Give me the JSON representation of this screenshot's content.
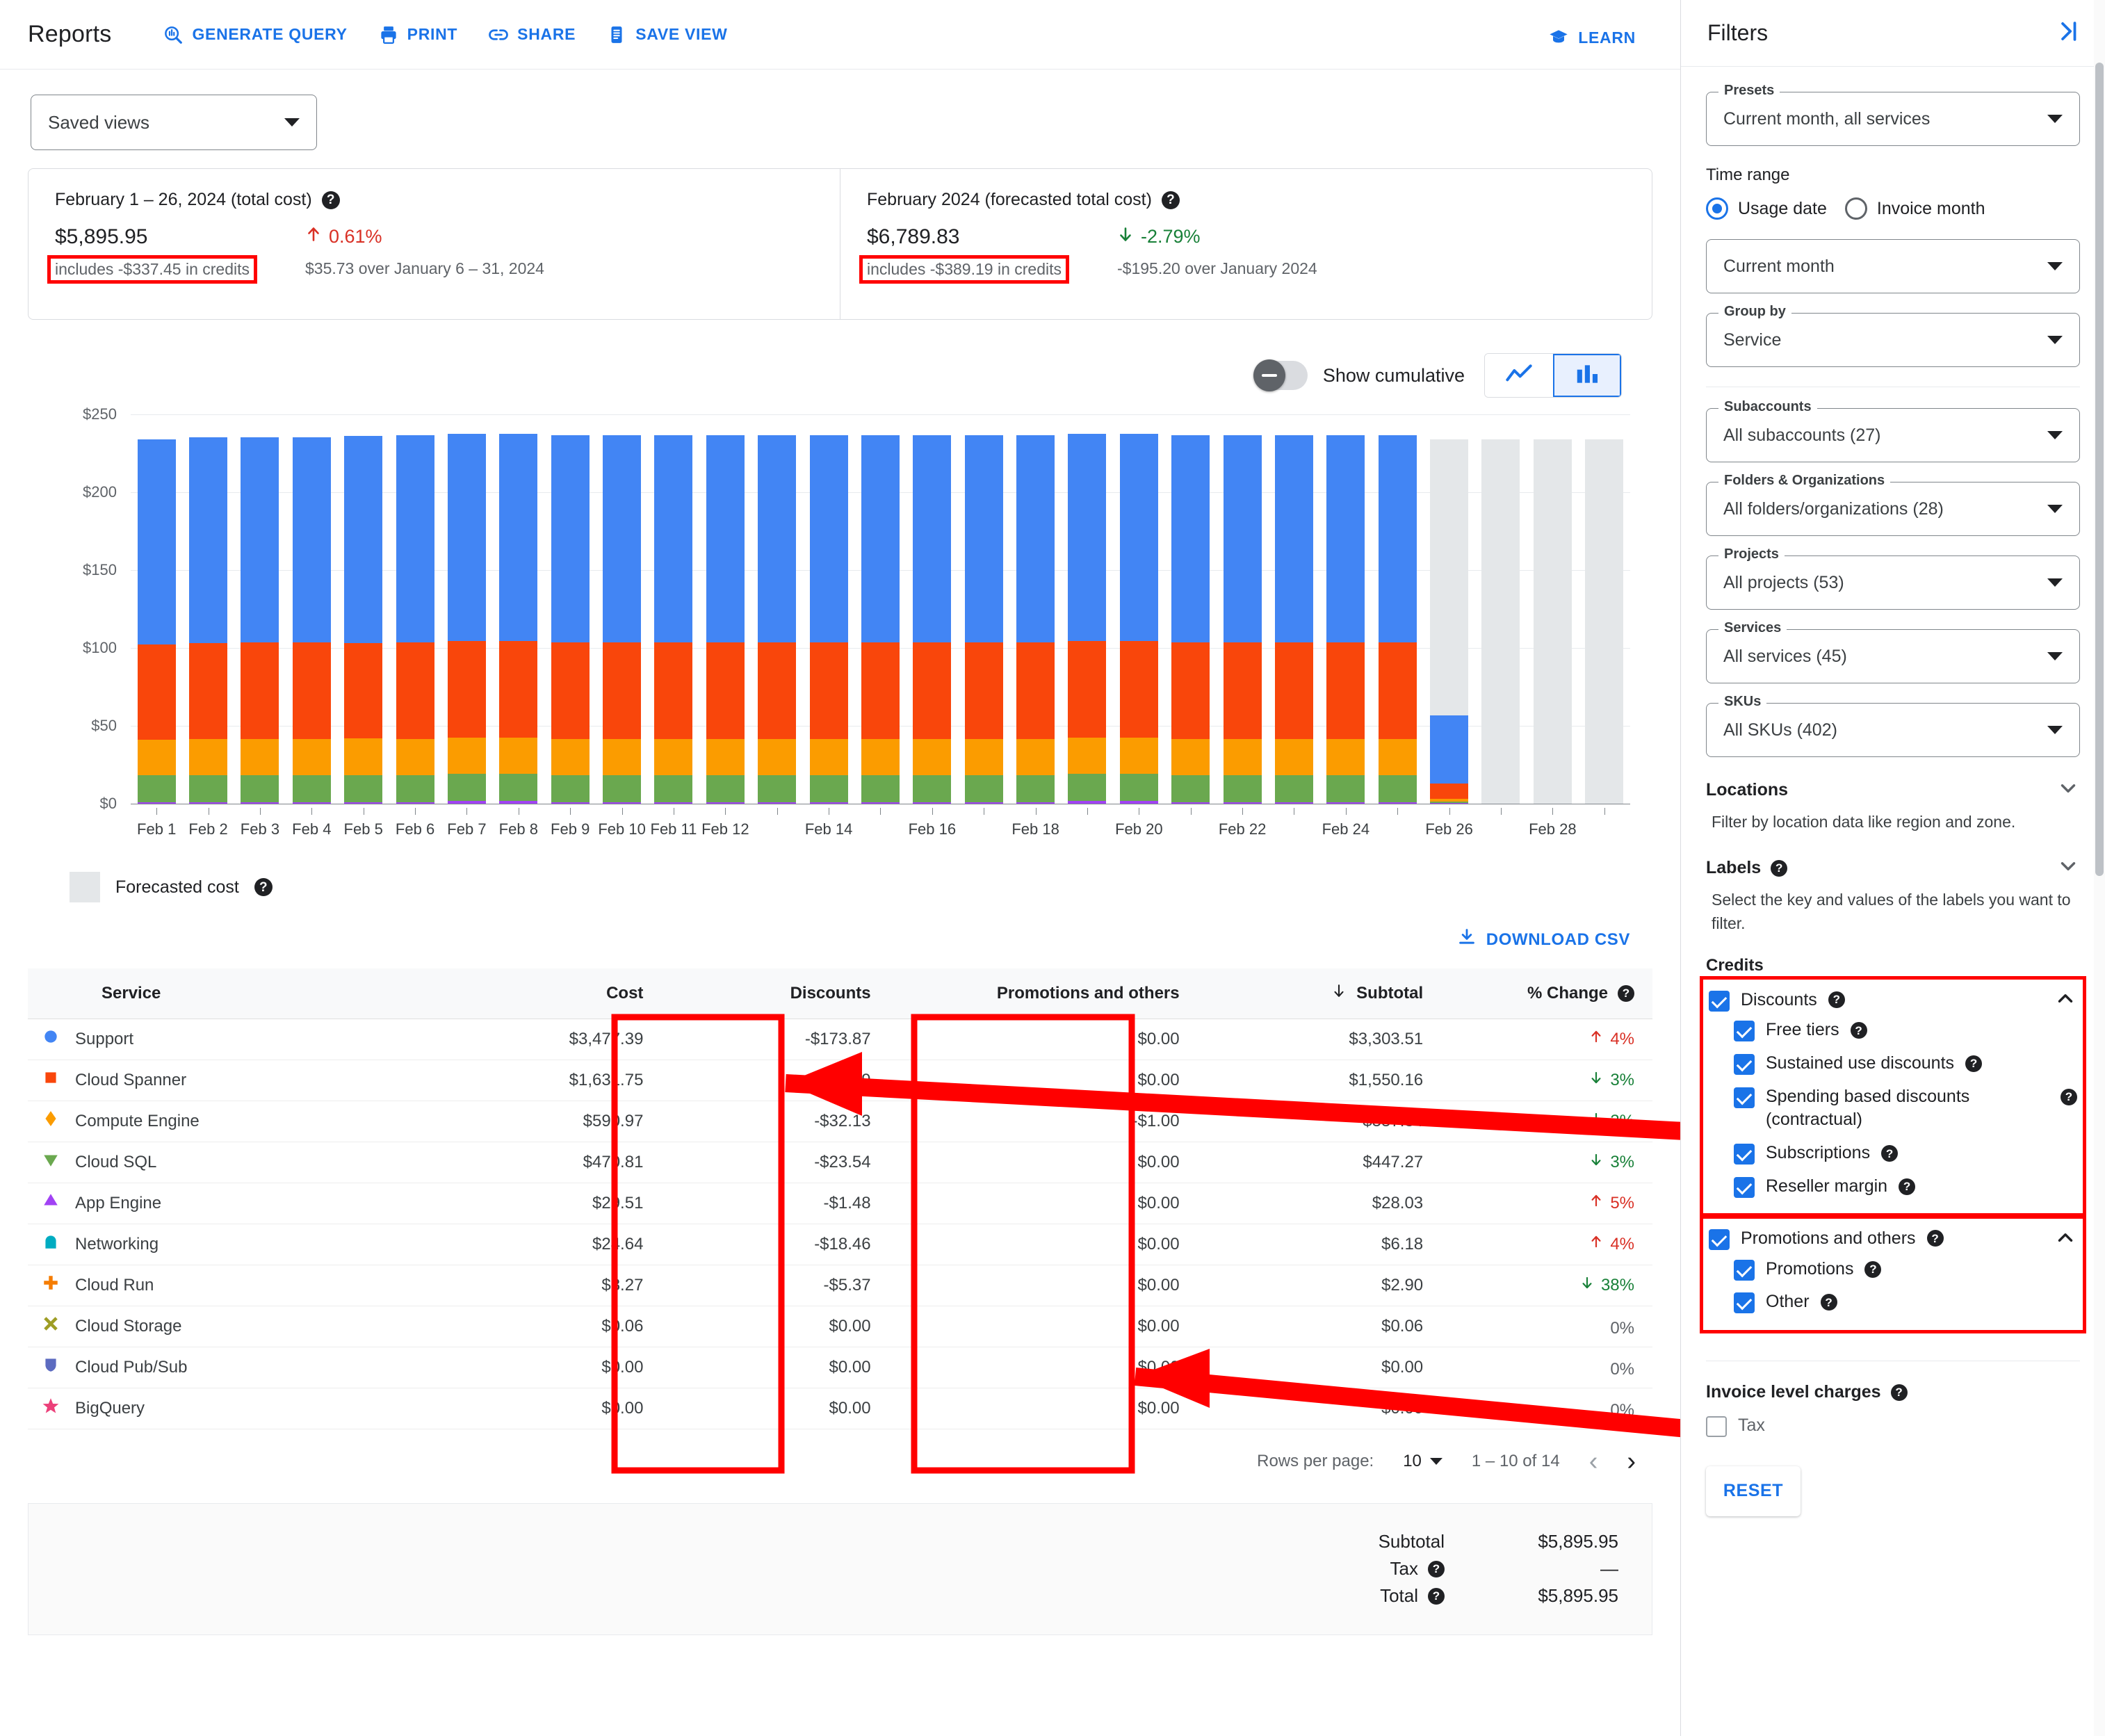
{
  "header": {
    "title": "Reports",
    "actions": [
      {
        "label": "GENERATE QUERY",
        "icon": "generate-query-icon"
      },
      {
        "label": "PRINT",
        "icon": "print-icon"
      },
      {
        "label": "SHARE",
        "icon": "share-icon"
      },
      {
        "label": "SAVE VIEW",
        "icon": "save-view-icon"
      }
    ],
    "learn_label": "LEARN"
  },
  "saved_views": {
    "label": "Saved views"
  },
  "summary": {
    "current": {
      "title": "February 1 – 26, 2024 (total cost)",
      "amount": "$5,895.95",
      "credits": "includes -$337.45 in credits",
      "change_pct": "0.61%",
      "change_dir": "up",
      "change_sub": "$35.73 over January 6 – 31, 2024"
    },
    "forecast": {
      "title": "February 2024 (forecasted total cost)",
      "amount": "$6,789.83",
      "credits": "includes -$389.19 in credits",
      "change_pct": "-2.79%",
      "change_dir": "down",
      "change_sub": "-$195.20 over January 2024"
    }
  },
  "chart_controls": {
    "cumulative_label": "Show cumulative",
    "cumulative_on": false,
    "line_icon": "line-chart-icon",
    "bar_icon": "bar-chart-icon",
    "selected_type": "bar"
  },
  "legend": {
    "forecast_label": "Forecasted cost",
    "forecast_color": "#e4e7e9"
  },
  "download": {
    "label": "DOWNLOAD CSV",
    "icon": "download-icon"
  },
  "chart_data": {
    "type": "bar",
    "stacked": true,
    "title": "",
    "xlabel": "",
    "ylabel": "",
    "ylim": [
      0,
      250
    ],
    "yticks": [
      "$0",
      "$50",
      "$100",
      "$150",
      "$200",
      "$250"
    ],
    "ytick_values": [
      0,
      50,
      100,
      150,
      200,
      250
    ],
    "grid": true,
    "legend_position": "below",
    "x": [
      "Feb 1",
      "Feb 2",
      "Feb 3",
      "Feb 4",
      "Feb 5",
      "Feb 6",
      "Feb 7",
      "Feb 8",
      "Feb 9",
      "Feb 10",
      "Feb 11",
      "Feb 12",
      "Feb 13",
      "Feb 14",
      "Feb 15",
      "Feb 16",
      "Feb 17",
      "Feb 18",
      "Feb 19",
      "Feb 20",
      "Feb 21",
      "Feb 22",
      "Feb 23",
      "Feb 24",
      "Feb 25",
      "Feb 26",
      "Feb 27",
      "Feb 28",
      "Feb 29"
    ],
    "xtick_labels": [
      "Feb 1",
      "Feb 2",
      "Feb 3",
      "Feb 4",
      "Feb 5",
      "Feb 6",
      "Feb 7",
      "Feb 8",
      "Feb 9",
      "Feb 10",
      "Feb 11",
      "Feb 12",
      "",
      "Feb 14",
      "",
      "Feb 16",
      "",
      "Feb 18",
      "",
      "Feb 20",
      "",
      "Feb 22",
      "",
      "Feb 24",
      "",
      "Feb 26",
      "",
      "Feb 28",
      ""
    ],
    "series": [
      {
        "name": "App Engine",
        "color": "#a142f4",
        "values": [
          1.1,
          1.1,
          1.1,
          1.1,
          1.1,
          1.1,
          1.9,
          1.9,
          1.1,
          1.1,
          1.1,
          1.1,
          1.1,
          1.1,
          1.1,
          1.1,
          1.1,
          1.1,
          1.9,
          1.9,
          1.1,
          1.1,
          1.1,
          1.1,
          1.1,
          0.25,
          0,
          0,
          0
        ]
      },
      {
        "name": "Cloud SQL",
        "color": "#6aa84f",
        "values": [
          17.3,
          17.3,
          17.3,
          17.3,
          17.3,
          17.3,
          17.3,
          17.3,
          17.3,
          17.3,
          17.3,
          17.3,
          17.3,
          17.3,
          17.3,
          17.3,
          17.3,
          17.3,
          17.3,
          17.3,
          17.3,
          17.3,
          17.3,
          17.3,
          17.3,
          1.2,
          0,
          0,
          0
        ]
      },
      {
        "name": "Compute Engine",
        "color": "#fb9c00",
        "values": [
          22.5,
          23.1,
          23.3,
          23.3,
          23.6,
          23.3,
          23.3,
          23.3,
          23.3,
          23.3,
          23.3,
          23.3,
          23.3,
          23.3,
          23.3,
          23.3,
          23.3,
          23.3,
          23.3,
          23.3,
          23.3,
          23.3,
          23.3,
          23.3,
          23.3,
          1.8,
          0,
          0,
          0
        ]
      },
      {
        "name": "Cloud Spanner",
        "color": "#f9460b",
        "values": [
          61.5,
          61.7,
          61.7,
          61.7,
          61.3,
          62.0,
          62.0,
          62.0,
          62.0,
          62.0,
          62.0,
          62.0,
          62.0,
          62.0,
          62.0,
          62.0,
          62.0,
          62.0,
          62.0,
          62.0,
          62.0,
          62.0,
          62.0,
          62.0,
          62.0,
          9.5,
          0,
          0,
          0
        ]
      },
      {
        "name": "Support",
        "color": "#4285f4",
        "values": [
          131.5,
          132.1,
          132.1,
          132.0,
          133.0,
          132.8,
          132.9,
          132.9,
          132.9,
          132.9,
          132.9,
          132.9,
          132.9,
          132.9,
          132.9,
          132.9,
          132.9,
          132.9,
          132.9,
          132.9,
          132.9,
          132.9,
          132.9,
          132.9,
          132.9,
          44.0,
          0,
          0,
          0
        ]
      }
    ],
    "forecast_bars": [
      {
        "x": "Feb 26",
        "value": 234,
        "color": "#e4e7e9"
      },
      {
        "x": "Feb 27",
        "value": 234,
        "color": "#e4e7e9"
      },
      {
        "x": "Feb 28",
        "value": 234,
        "color": "#e4e7e9"
      },
      {
        "x": "Feb 29",
        "value": 234,
        "color": "#e4e7e9"
      }
    ]
  },
  "table": {
    "columns": [
      "Service",
      "Cost",
      "Discounts",
      "Promotions and others",
      "Subtotal",
      "% Change"
    ],
    "sorted_column": "Subtotal",
    "sort_dir": "desc",
    "rows": [
      {
        "marker": "circle",
        "color": "#4285f4",
        "service": "Support",
        "cost": "$3,477.39",
        "discounts": "-$173.87",
        "promotions": "$0.00",
        "subtotal": "$3,303.51",
        "change": "4%",
        "dir": "up"
      },
      {
        "marker": "square",
        "color": "#f9460b",
        "service": "Cloud Spanner",
        "cost": "$1,631.75",
        "discounts": "-$81.59",
        "promotions": "$0.00",
        "subtotal": "$1,550.16",
        "change": "3%",
        "dir": "down"
      },
      {
        "marker": "diamond",
        "color": "#fb9c00",
        "service": "Compute Engine",
        "cost": "$590.97",
        "discounts": "-$32.13",
        "promotions": "-$1.00",
        "subtotal": "$557.84",
        "change": "3%",
        "dir": "down"
      },
      {
        "marker": "triangle-down",
        "color": "#6aa84f",
        "service": "Cloud SQL",
        "cost": "$470.81",
        "discounts": "-$23.54",
        "promotions": "$0.00",
        "subtotal": "$447.27",
        "change": "3%",
        "dir": "down"
      },
      {
        "marker": "triangle-up",
        "color": "#a142f4",
        "service": "App Engine",
        "cost": "$29.51",
        "discounts": "-$1.48",
        "promotions": "$0.00",
        "subtotal": "$28.03",
        "change": "5%",
        "dir": "up"
      },
      {
        "marker": "pentagon",
        "color": "#00acc1",
        "service": "Networking",
        "cost": "$24.64",
        "discounts": "-$18.46",
        "promotions": "$0.00",
        "subtotal": "$6.18",
        "change": "4%",
        "dir": "up"
      },
      {
        "marker": "plus",
        "color": "#f57c00",
        "service": "Cloud Run",
        "cost": "$8.27",
        "discounts": "-$5.37",
        "promotions": "$0.00",
        "subtotal": "$2.90",
        "change": "38%",
        "dir": "down"
      },
      {
        "marker": "cross",
        "color": "#9e9d24",
        "service": "Cloud Storage",
        "cost": "$0.06",
        "discounts": "$0.00",
        "promotions": "$0.00",
        "subtotal": "$0.06",
        "change": "0%",
        "dir": "flat"
      },
      {
        "marker": "shield",
        "color": "#5c6bc0",
        "service": "Cloud Pub/Sub",
        "cost": "$0.00",
        "discounts": "$0.00",
        "promotions": "$0.00",
        "subtotal": "$0.00",
        "change": "0%",
        "dir": "flat"
      },
      {
        "marker": "star",
        "color": "#ec407a",
        "service": "BigQuery",
        "cost": "$0.00",
        "discounts": "$0.00",
        "promotions": "$0.00",
        "subtotal": "$0.00",
        "change": "0%",
        "dir": "flat"
      }
    ]
  },
  "pagination": {
    "rows_per_page_label": "Rows per page:",
    "rows_per_page_value": "10",
    "range": "1 – 10 of 14",
    "prev_icon": "chevron-left-icon",
    "next_icon": "chevron-right-icon"
  },
  "totals": {
    "subtotal_label": "Subtotal",
    "subtotal_value": "$5,895.95",
    "tax_label": "Tax",
    "tax_value": "—",
    "total_label": "Total",
    "total_value": "$5,895.95"
  },
  "filters": {
    "title": "Filters",
    "collapse_icon": "panel-collapse-icon",
    "presets": {
      "legend": "Presets",
      "value": "Current month, all services"
    },
    "time_range": {
      "label": "Time range",
      "options": [
        {
          "label": "Usage date",
          "selected": true
        },
        {
          "label": "Invoice month",
          "selected": false
        }
      ],
      "value": "Current month"
    },
    "group_by": {
      "legend": "Group by",
      "value": "Service"
    },
    "selectors": [
      {
        "legend": "Subaccounts",
        "value": "All subaccounts (27)"
      },
      {
        "legend": "Folders & Organizations",
        "value": "All folders/organizations (28)"
      },
      {
        "legend": "Projects",
        "value": "All projects (53)"
      },
      {
        "legend": "Services",
        "value": "All services (45)"
      },
      {
        "legend": "SKUs",
        "value": "All SKUs (402)"
      }
    ],
    "locations": {
      "title": "Locations",
      "desc": "Filter by location data like region and zone."
    },
    "labels": {
      "title": "Labels",
      "desc": "Select the key and values of the labels you want to filter."
    },
    "credits": {
      "title": "Credits",
      "discounts": {
        "label": "Discounts",
        "checked": true,
        "expanded": true,
        "children": [
          {
            "label": "Free tiers",
            "checked": true
          },
          {
            "label": "Sustained use discounts",
            "checked": true
          },
          {
            "label": "Spending based discounts (contractual)",
            "checked": true
          },
          {
            "label": "Subscriptions",
            "checked": true
          },
          {
            "label": "Reseller margin",
            "checked": true
          }
        ]
      },
      "promotions": {
        "label": "Promotions and others",
        "checked": true,
        "expanded": true,
        "children": [
          {
            "label": "Promotions",
            "checked": true
          },
          {
            "label": "Other",
            "checked": true
          }
        ]
      }
    },
    "invoice_level_charges": {
      "title": "Invoice level charges",
      "tax_label": "Tax",
      "tax_checked": false
    },
    "reset_label": "RESET"
  },
  "annotations": {
    "highlight_color": "#ff0000",
    "boxes": [
      "credits-current",
      "credits-forecast",
      "discounts-column",
      "promotions-column",
      "discounts-filter",
      "promotions-filter"
    ],
    "arrows": [
      "discounts-column-to-discounts-filter",
      "promotions-column-to-promotions-filter"
    ]
  }
}
